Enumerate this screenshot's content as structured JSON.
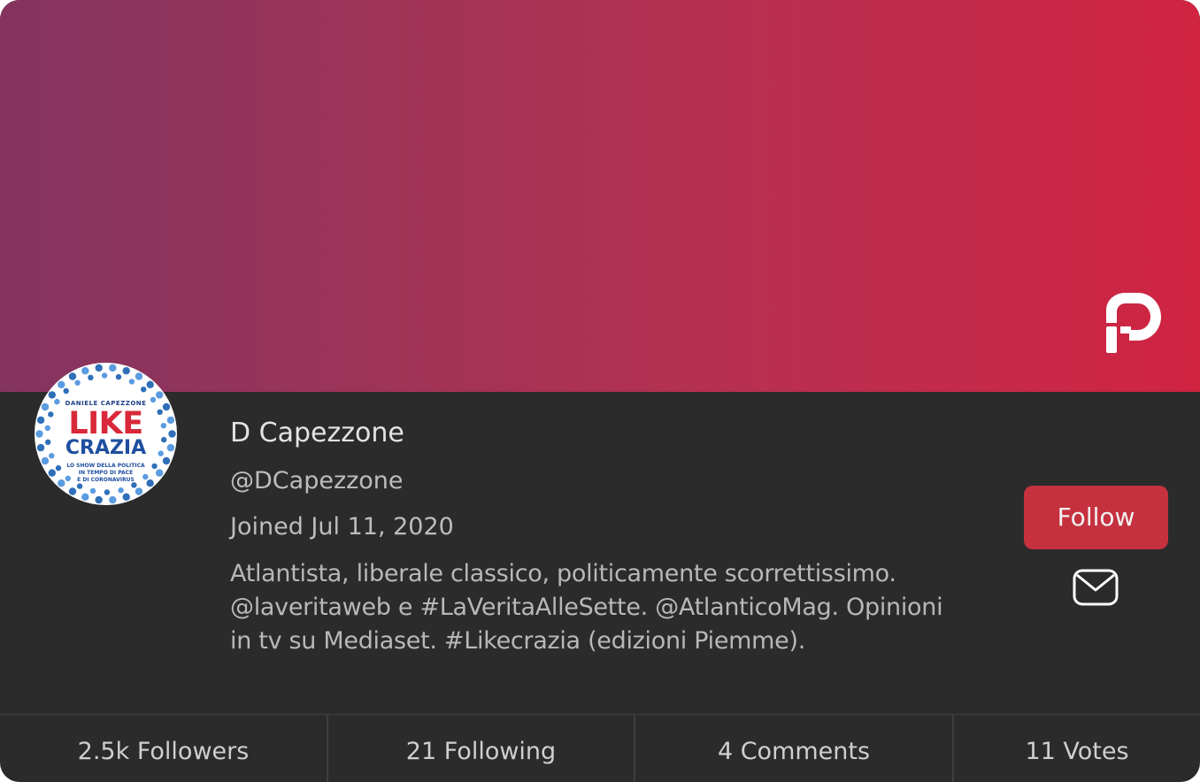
{
  "profile": {
    "display_name": "D Capezzone",
    "handle": "@DCapezzone",
    "joined": "Joined Jul 11, 2020",
    "bio_lines": [
      "Atlantista, liberale classico, politicamente scorrettissimo.",
      "@laveritaweb e #LaVeritaAlleSette. @AtlanticoMag. Opinioni",
      "in tv su Mediaset. #Likecrazia (edizioni Piemme)."
    ]
  },
  "avatar": {
    "author": "DANIELE CAPEZZONE",
    "title_top": "LIKE",
    "title_bottom": "CRAZIA",
    "subtitle_lines": [
      "LO SHOW DELLA POLITICA",
      "IN TEMPO DI PACE",
      "E DI CORONAVIRUS"
    ]
  },
  "actions": {
    "follow_label": "Follow",
    "message_icon": "mail-icon"
  },
  "brand": {
    "logo_icon": "parler-logo-icon",
    "banner_gradient": [
      "#84345f",
      "#d02441"
    ],
    "button_color": "#c6313f",
    "background": "#2b2b2b"
  },
  "stats": {
    "followers": "2.5k Followers",
    "following": "21 Following",
    "comments": "4 Comments",
    "votes": "11 Votes"
  }
}
